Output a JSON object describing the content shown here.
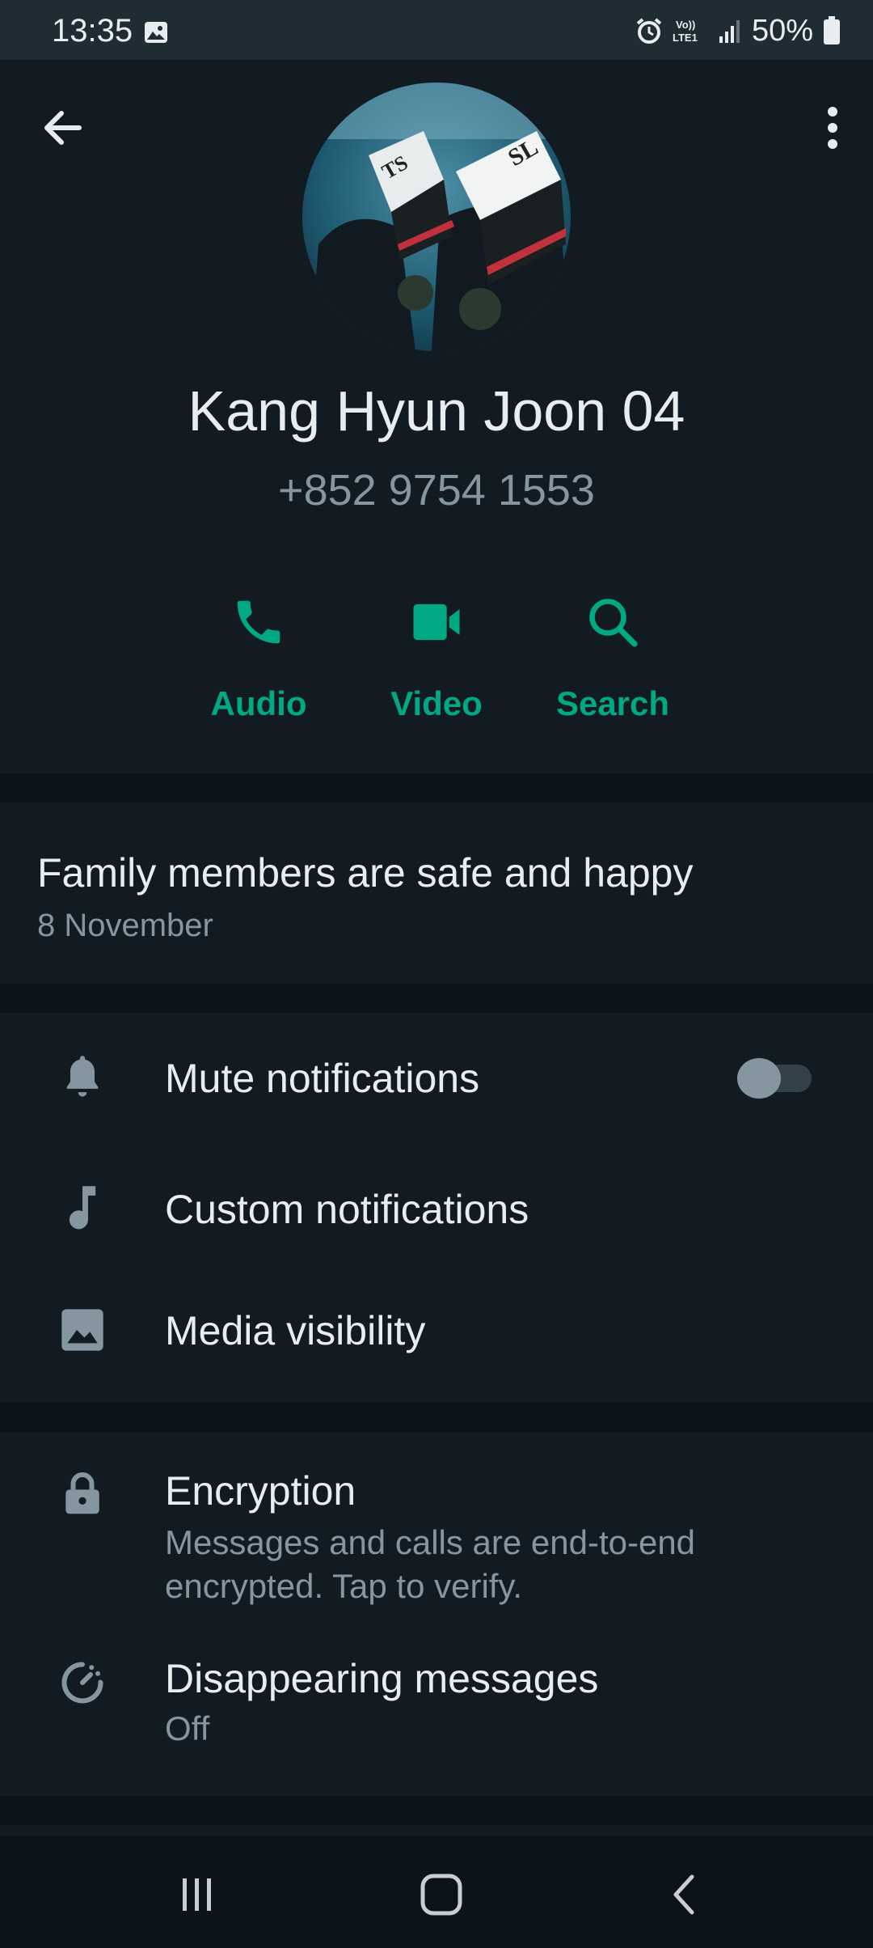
{
  "status_bar": {
    "time": "13:35",
    "battery": "50%",
    "icons": [
      "gallery-icon",
      "alarm-icon",
      "volte-icon",
      "signal-icon",
      "battery-icon"
    ]
  },
  "header": {
    "back_icon": "arrow-back-icon",
    "menu_icon": "more-vert-icon"
  },
  "profile": {
    "name": "Kang Hyun Joon 04",
    "phone": "+852 9754 1553"
  },
  "actions": [
    {
      "label": "Audio",
      "icon": "phone-icon"
    },
    {
      "label": "Video",
      "icon": "video-icon"
    },
    {
      "label": "Search",
      "icon": "search-icon"
    }
  ],
  "about": {
    "text": "Family members are safe and happy",
    "date": "8 November"
  },
  "settings": {
    "mute": {
      "label": "Mute notifications",
      "enabled": false
    },
    "custom": {
      "label": "Custom notifications"
    },
    "media": {
      "label": "Media visibility"
    }
  },
  "privacy": {
    "encryption": {
      "label": "Encryption",
      "sub": "Messages and calls are end-to-end encrypted. Tap to verify."
    },
    "disappearing": {
      "label": "Disappearing messages",
      "sub": "Off"
    }
  },
  "colors": {
    "accent": "#00a884",
    "background": "#0b141a",
    "card": "#121b22",
    "muted": "#8696a0"
  }
}
